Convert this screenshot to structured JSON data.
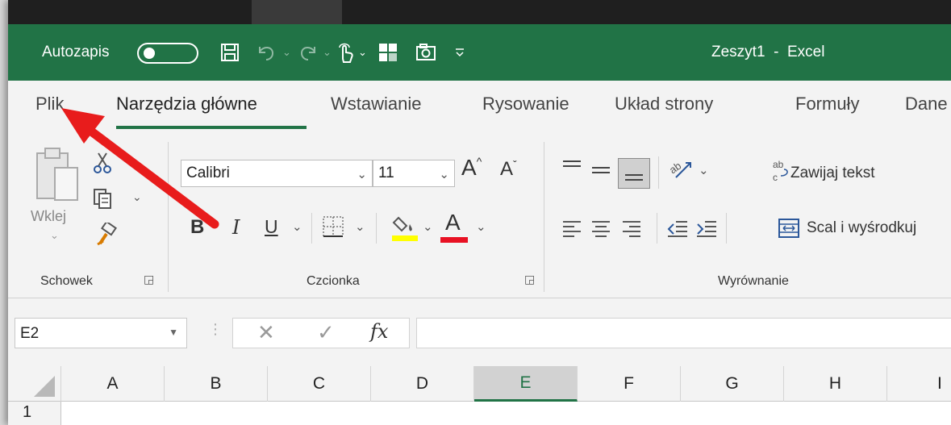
{
  "titlebar": {
    "autosave_label": "Autozapis",
    "document_title": "Zeszyt1  -  Excel",
    "accent_color": "#217346"
  },
  "tabs": [
    {
      "label": "Plik"
    },
    {
      "label": "Narzędzia główne",
      "active": true
    },
    {
      "label": "Wstawianie"
    },
    {
      "label": "Rysowanie"
    },
    {
      "label": "Układ strony"
    },
    {
      "label": "Formuły"
    },
    {
      "label": "Dane"
    }
  ],
  "clipboard": {
    "paste_label": "Wklej",
    "group_label": "Schowek"
  },
  "font": {
    "font_name": "Calibri",
    "font_size": "11",
    "bold": "B",
    "italic": "I",
    "underline": "U",
    "grow": "A",
    "shrink": "A",
    "font_color_label": "A",
    "group_label": "Czcionka",
    "highlight_color": "#ffff00",
    "font_color": "#e81123"
  },
  "alignment": {
    "wrap_text": "Zawijaj tekst",
    "merge_center": "Scal i wyśrodkuj",
    "group_label": "Wyrównanie"
  },
  "formula_bar": {
    "name_box": "E2",
    "fx": "fx",
    "formula": ""
  },
  "grid": {
    "columns": [
      "A",
      "B",
      "C",
      "D",
      "E",
      "F",
      "G",
      "H",
      "I"
    ],
    "selected_column": "E",
    "rows": [
      "1"
    ]
  },
  "annotation": {
    "arrow_color": "#e81c1c",
    "points_to": "Plik"
  }
}
